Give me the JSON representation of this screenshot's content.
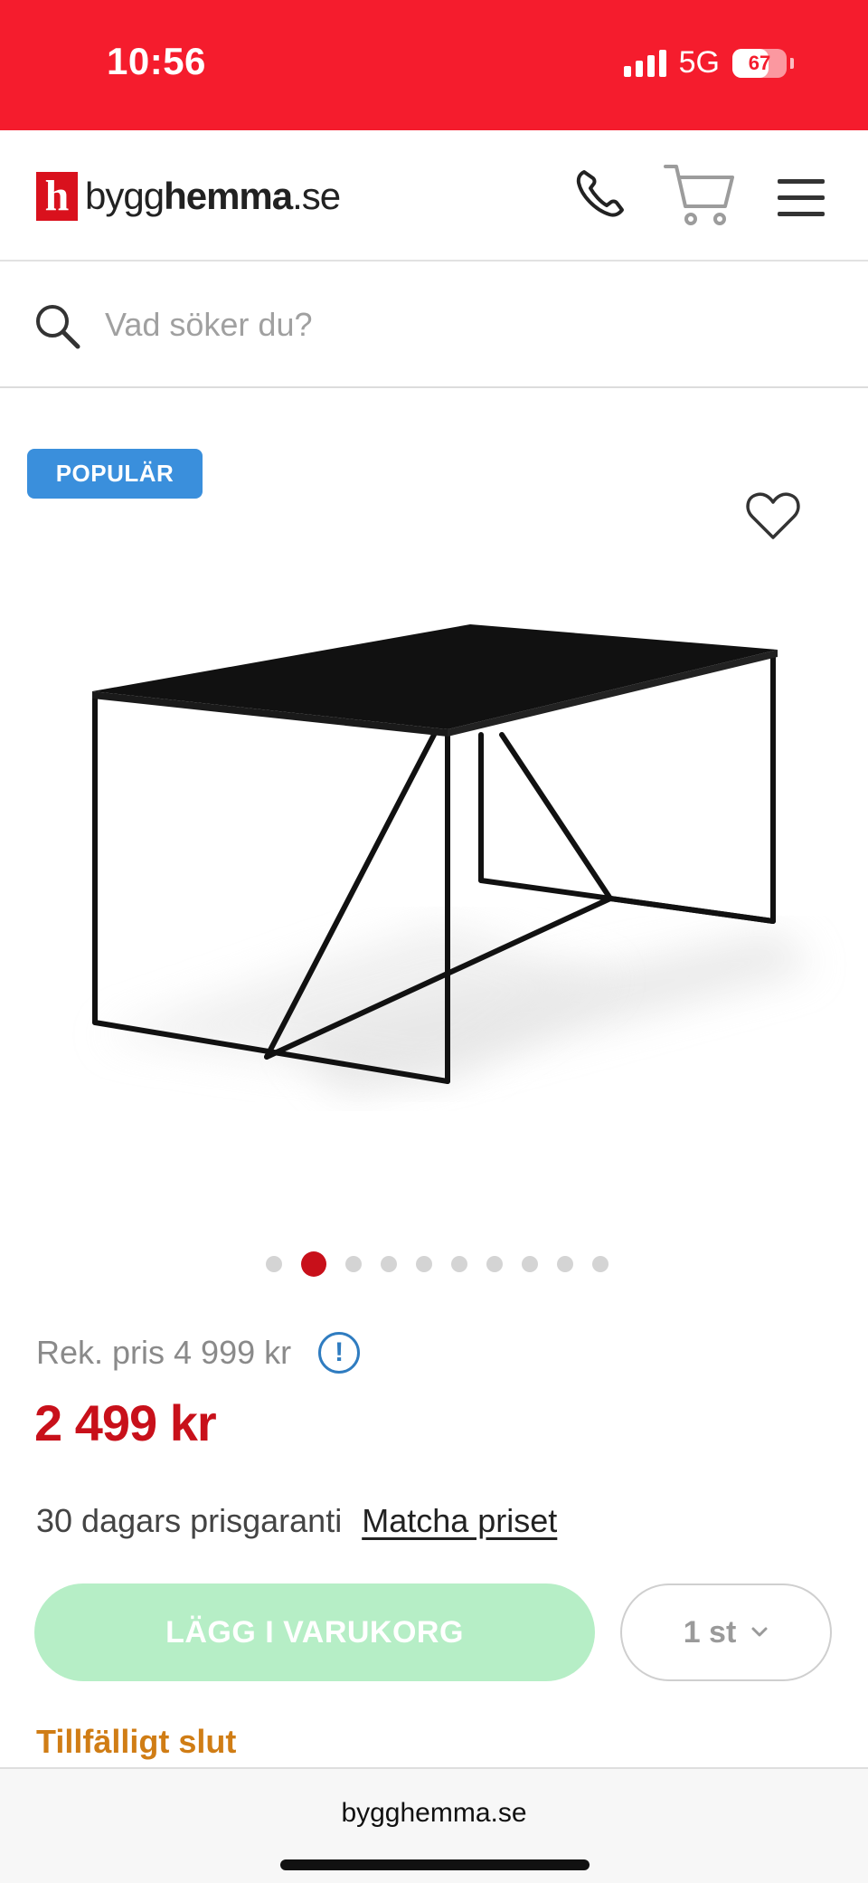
{
  "status_bar": {
    "time": "10:56",
    "network": "5G",
    "battery_level": "67",
    "background_color": "#f51c2d"
  },
  "header": {
    "logo_mark": "h",
    "logo_text_regular": "bygg",
    "logo_text_bold": "hemma",
    "logo_text_suffix": ".se",
    "icons": [
      "phone-icon",
      "cart-icon",
      "menu-icon"
    ]
  },
  "search": {
    "placeholder": "Vad söker du?",
    "value": ""
  },
  "product": {
    "badge": "POPULÄR",
    "image_count": 10,
    "active_image_index": 2,
    "rek_price": "Rek. pris 4 999 kr",
    "info_icon_glyph": "!",
    "price": "2 499 kr",
    "guarantee_text": "30 dagars prisgaranti",
    "match_link": "Matcha priset",
    "add_to_cart": "LÄGG I VARUKORG",
    "quantity": "1 st",
    "stock_status": "Tillfälligt slut"
  },
  "colors": {
    "accent_red": "#c8101a",
    "badge_blue": "#3a8fdc",
    "disabled_green": "#b6eec6",
    "stock_orange": "#d07d15"
  },
  "browser": {
    "domain": "bygghemma.se"
  }
}
